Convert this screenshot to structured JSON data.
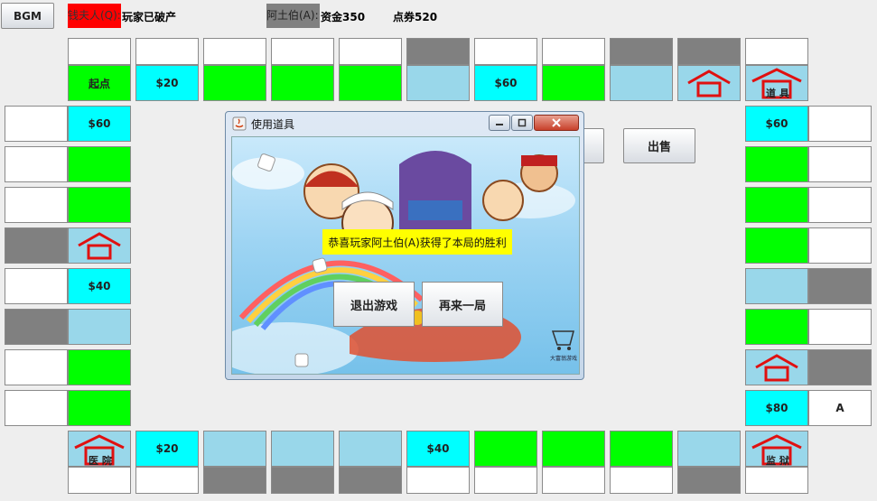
{
  "toolbar": {
    "bgm": "BGM"
  },
  "players": [
    {
      "tag": "钱夫人(Q):",
      "status": "玩家已破产",
      "tag_color": "#ff0000"
    },
    {
      "tag": "阿土伯(A):",
      "funds": "资金350",
      "coupons": "点券520",
      "tag_color": "#808080"
    }
  ],
  "actions": {
    "sell": "出售"
  },
  "board": {
    "start": "起点",
    "tool": "道 具",
    "hospital": "医 院",
    "prison": "监 狱",
    "prices": {
      "s20": "$20",
      "s60": "$60",
      "s40": "$40",
      "s80": "$80"
    },
    "player_token": "A"
  },
  "dialog": {
    "title": "使用道具",
    "message": "恭喜玩家阿土伯(A)获得了本局的胜利",
    "exit_label": "退出游戏",
    "again_label": "再来一局",
    "watermark": "大富翁游戏"
  },
  "colors": {
    "green": "#00ff00",
    "cyan": "#00ffff",
    "light_blue": "#99d7ea",
    "gray": "#808080",
    "red": "#ff0000"
  }
}
